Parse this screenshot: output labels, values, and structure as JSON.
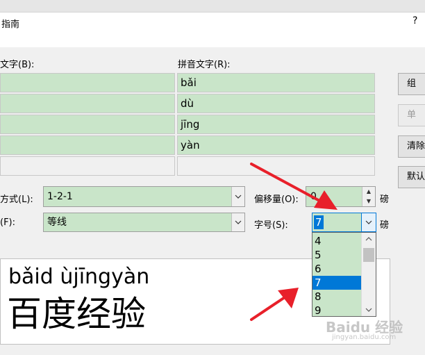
{
  "dialog": {
    "title": "指南",
    "help": "?"
  },
  "labels": {
    "base_text": "文字(B):",
    "ruby_text": "拼音文字(R):",
    "alignment": "方式(L):",
    "offset": "偏移量(O):",
    "font": "(F):",
    "size": "字号(S):",
    "unit_offset": "磅",
    "unit_size": "磅"
  },
  "ruby_rows": [
    "bǎi",
    "dù",
    "jīng",
    "yàn",
    ""
  ],
  "buttons": {
    "group": "组",
    "single": "单",
    "clear": "清除",
    "default": "默认"
  },
  "alignment_value": "1-2-1",
  "offset_value": "0",
  "font_value": "等线",
  "size_value": "7",
  "size_options": [
    "4",
    "5",
    "6",
    "7",
    "8",
    "9"
  ],
  "size_selected_index": 3,
  "preview": {
    "pinyin": "bǎid ùjīngyàn",
    "hanzi": "百度经验"
  },
  "watermark": {
    "brand": "Baidu 经验",
    "url": "jingyan.baidu.com"
  },
  "colors": {
    "field_bg": "#c9e5c9",
    "selection": "#0078d7",
    "arrow": "#e8202a"
  }
}
